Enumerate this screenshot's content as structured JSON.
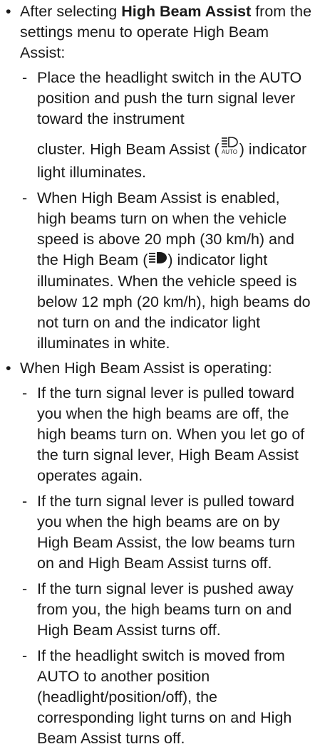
{
  "section1": {
    "bullet": "•",
    "intro_pre": "After selecting ",
    "intro_bold": "High Beam Assist",
    "intro_post": " from the settings menu to operate High Beam Assist:",
    "items": [
      {
        "dash": "-",
        "line1": "Place the headlight switch in the AUTO position and push the turn signal lever toward the instrument",
        "line2_pre": "cluster. High Beam Assist (",
        "icon_label": "AUTO",
        "line2_post": ") indicator light illuminates."
      },
      {
        "dash": "-",
        "line1": "When High Beam Assist is enabled, high beams turn on when the vehicle speed is above 20 mph (30 km/h) and",
        "line2_pre": "the High Beam (",
        "line2_post": ") indicator light illuminates. When the vehicle speed is below 12 mph (20 km/h), high beams do not turn on and the indicator light illuminates in white."
      }
    ]
  },
  "section2": {
    "bullet": "•",
    "intro": "When High Beam Assist is operating:",
    "items": [
      {
        "dash": "-",
        "text": "If the turn signal lever is pulled toward you when the high beams are off, the high beams turn on. When you let go of the turn signal lever, High Beam Assist operates again."
      },
      {
        "dash": "-",
        "text": "If the turn signal lever is pulled toward you when the high beams are on by High Beam Assist, the low beams turn on and High Beam Assist turns off."
      },
      {
        "dash": "-",
        "text": "If the turn signal lever is pushed away from you, the high beams turn on and High Beam Assist turns off."
      },
      {
        "dash": "-",
        "text": "If the headlight switch is moved from AUTO to another position (headlight/position/off), the corresponding light turns on and High Beam Assist turns off."
      }
    ]
  }
}
